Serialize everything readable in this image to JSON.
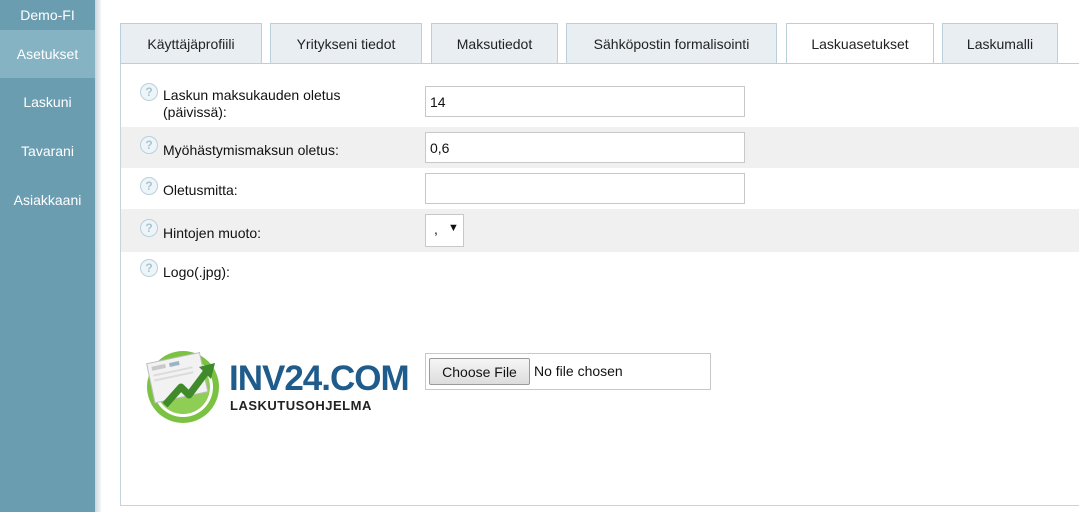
{
  "sidebar": {
    "brand": "Demo-FI",
    "items": [
      {
        "label": "Asetukset",
        "active": true
      },
      {
        "label": "Laskuni",
        "active": false
      },
      {
        "label": "Tavarani",
        "active": false
      },
      {
        "label": "Asiakkaani",
        "active": false
      }
    ]
  },
  "tabs": [
    {
      "label": "Käyttäjäprofiili",
      "active": false
    },
    {
      "label": "Yritykseni tiedot",
      "active": false
    },
    {
      "label": "Maksutiedot",
      "active": false
    },
    {
      "label": "Sähköpostin formalisointi",
      "active": false
    },
    {
      "label": "Laskuasetukset",
      "active": true
    },
    {
      "label": "Laskumalli",
      "active": false
    }
  ],
  "form": {
    "help_icon_glyph": "?",
    "payment_period": {
      "label": "Laskun maksukauden oletus (päivissä):",
      "value": "14"
    },
    "late_fee": {
      "label": "Myöhästymismaksun oletus:",
      "value": "0,6"
    },
    "default_unit": {
      "label": "Oletusmitta:",
      "value": ""
    },
    "price_format": {
      "label": "Hintojen muoto:",
      "value": ",",
      "arrow": "▼"
    },
    "logo": {
      "label": "Logo(.jpg):",
      "logo_text": "INV24.COM",
      "logo_subtext": "LASKUTUSOHJELMA",
      "choose_file_label": "Choose File",
      "no_file_text": "No file chosen"
    }
  },
  "colors": {
    "sidebar_bg": "#6b9db1",
    "sidebar_active": "#86b3c4",
    "tab_bg": "#e8eef2",
    "logo_blue": "#1f5c8c",
    "logo_green": "#7cc242"
  }
}
